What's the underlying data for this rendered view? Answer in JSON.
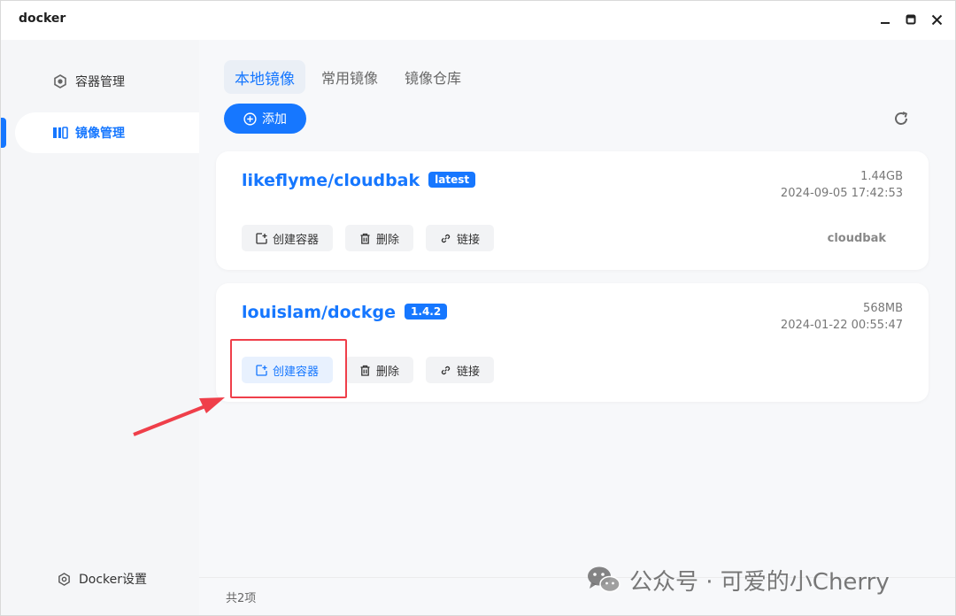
{
  "window": {
    "title": "docker"
  },
  "sidebar": {
    "items": [
      {
        "label": "容器管理",
        "icon": "container-icon"
      },
      {
        "label": "镜像管理",
        "icon": "image-icon"
      }
    ],
    "settings_label": "Docker设置"
  },
  "tabs": [
    {
      "label": "本地镜像"
    },
    {
      "label": "常用镜像"
    },
    {
      "label": "镜像仓库"
    }
  ],
  "toolbar": {
    "add_label": "添加"
  },
  "images": [
    {
      "name": "likeflyme/cloudbak",
      "tag": "latest",
      "size": "1.44GB",
      "date": "2024-09-05 17:42:53",
      "container": "cloudbak",
      "actions": [
        "创建容器",
        "删除",
        "链接"
      ]
    },
    {
      "name": "louislam/dockge",
      "tag": "1.4.2",
      "size": "568MB",
      "date": "2024-01-22 00:55:47",
      "container": "",
      "actions": [
        "创建容器",
        "删除",
        "链接"
      ]
    }
  ],
  "footer": {
    "total": "共2项"
  },
  "watermark": {
    "text": "公众号 · 可爱的小Cherry"
  },
  "colors": {
    "accent": "#1677ff",
    "annotation": "#ef3f4a"
  }
}
